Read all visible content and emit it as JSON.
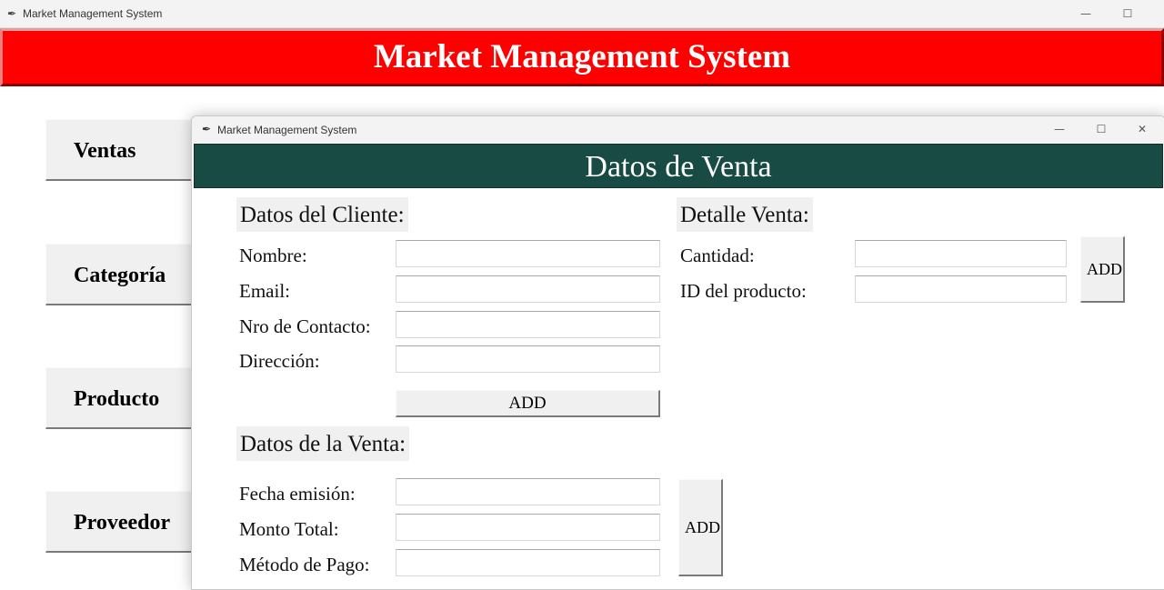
{
  "main_window": {
    "title": "Market Management System",
    "icon": "feather-icon",
    "banner_title": "Market Management System",
    "banner_color": "#ff0000"
  },
  "nav": {
    "ventas": "Ventas",
    "categoria": "Categoría",
    "producto": "Producto",
    "proveedor": "Proveedor"
  },
  "child_window": {
    "title": "Market Management System",
    "header": "Datos de Venta",
    "header_color": "#194b45"
  },
  "cliente": {
    "section": "Datos del Cliente:",
    "nombre_label": "Nombre:",
    "email_label": "Email:",
    "contacto_label": "Nro de Contacto:",
    "direccion_label": "Dirección:",
    "add_label": "ADD"
  },
  "detalle": {
    "section": "Detalle Venta:",
    "cantidad_label": "Cantidad:",
    "producto_label": "ID del producto:",
    "add_label": "ADD"
  },
  "venta": {
    "section": "Datos de la Venta:",
    "fecha_label": "Fecha emisión:",
    "monto_label": "Monto Total:",
    "pago_label": "Método de Pago:",
    "add_label": "ADD"
  },
  "controls": {
    "minimize": "—",
    "maximize": "☐",
    "close": "✕"
  }
}
